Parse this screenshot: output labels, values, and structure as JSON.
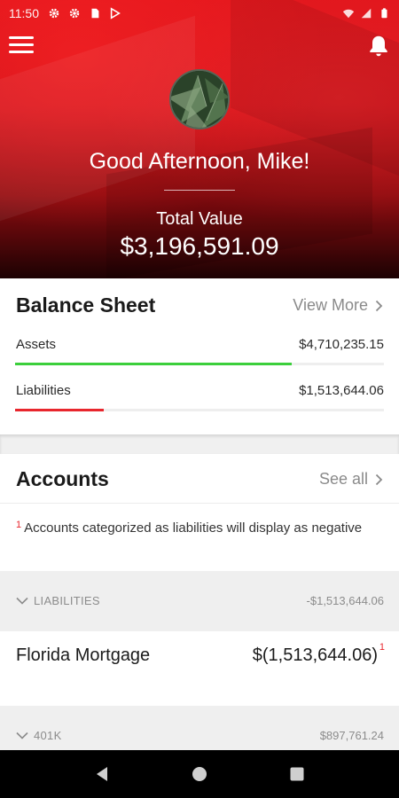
{
  "status_bar": {
    "time": "11:50"
  },
  "header": {
    "greeting": "Good Afternoon, Mike!",
    "total_label": "Total Value",
    "total_value": "$3,196,591.09"
  },
  "balance_sheet": {
    "title": "Balance Sheet",
    "view_more": "View More",
    "rows": [
      {
        "label": "Assets",
        "value": "$4,710,235.15",
        "bar_fraction": 0.75,
        "color": "#3ccf3c"
      },
      {
        "label": "Liabilities",
        "value": "$1,513,644.06",
        "bar_fraction": 0.24,
        "color": "#e8262d"
      }
    ]
  },
  "accounts": {
    "title": "Accounts",
    "see_all": "See all",
    "footnote_marker": "1",
    "footnote": "Accounts categorized as liabilities will display as negative",
    "groups": [
      {
        "name": "LIABILITIES",
        "total": "-$1,513,644.06",
        "items": [
          {
            "name": "Florida Mortgage",
            "value": "$(1,513,644.06)",
            "marker": "1"
          }
        ]
      },
      {
        "name": "401K",
        "total": "$897,761.24"
      }
    ]
  },
  "colors": {
    "brand_red": "#e0141b",
    "asset_green": "#3ccf3c",
    "liability_red": "#e8262d"
  }
}
